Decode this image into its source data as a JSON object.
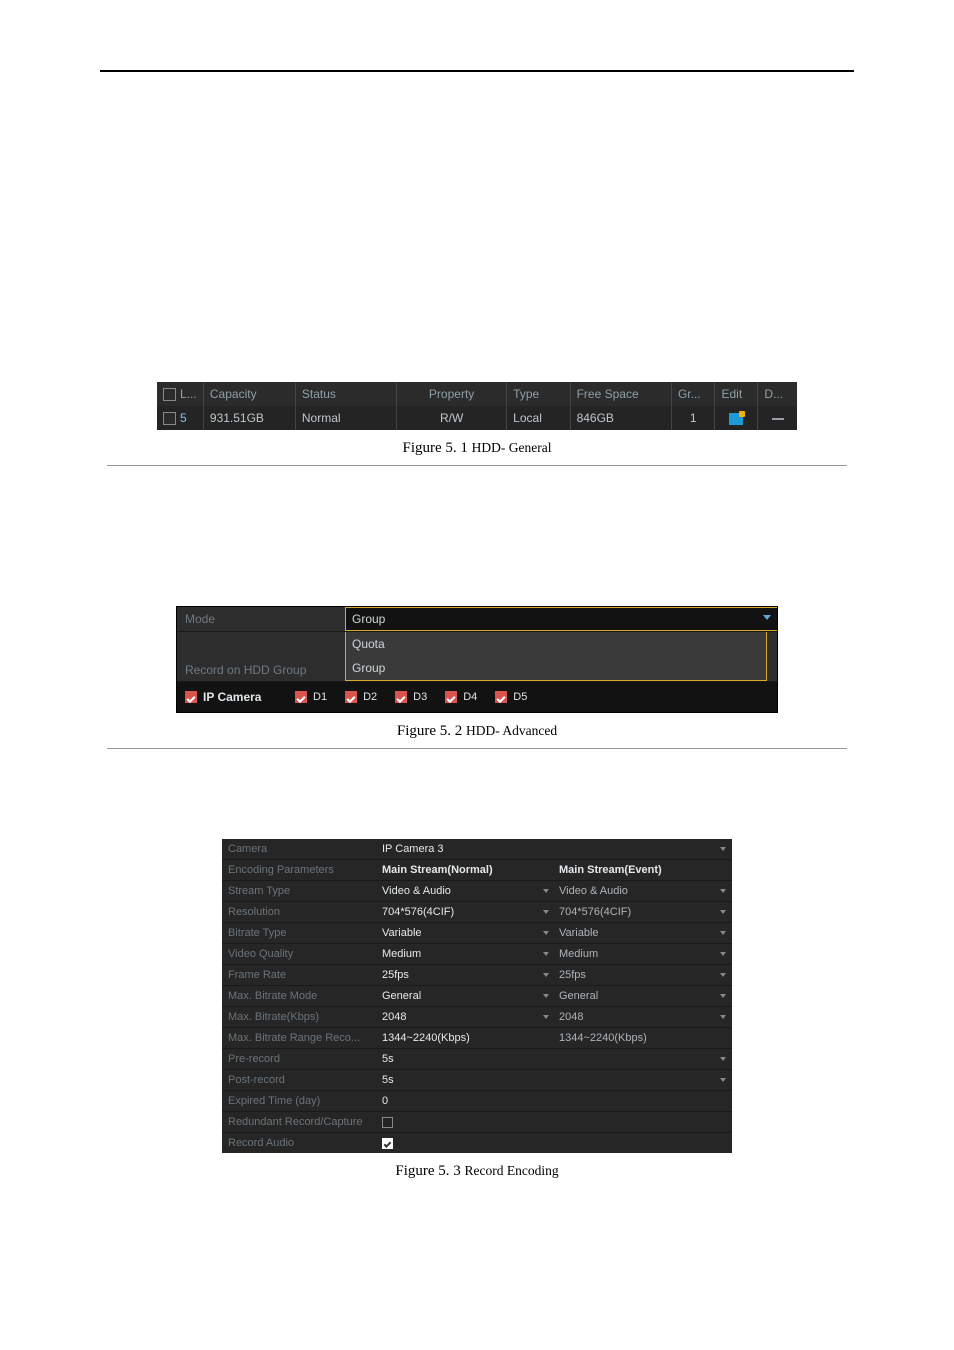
{
  "hdd_table": {
    "headers": {
      "col_l": "L...",
      "capacity": "Capacity",
      "status": "Status",
      "property": "Property",
      "type": "Type",
      "free_space": "Free Space",
      "group": "Gr...",
      "edit": "Edit",
      "del": "D..."
    },
    "row": {
      "l": "5",
      "capacity": "931.51GB",
      "status": "Normal",
      "property": "R/W",
      "type": "Local",
      "free_space": "846GB",
      "group": "1"
    }
  },
  "caption1_a": "Figure 5. 1 ",
  "caption1_b": "HDD- General",
  "mode_panel": {
    "mode_label": "Mode",
    "record_label": "Record on HDD Group",
    "options": {
      "quota": "Quota",
      "group": "Group"
    },
    "selected": "Group",
    "ip_camera": "IP Camera",
    "d1": "D1",
    "d2": "D2",
    "d3": "D3",
    "d4": "D4",
    "d5": "D5"
  },
  "caption2_a": "Figure 5. 2 ",
  "caption2_b": "HDD- Advanced",
  "enc": {
    "camera_label": "Camera",
    "camera_value": "IP Camera 3",
    "row_encparams": "Encoding Parameters",
    "c1_encparams": "Main Stream(Normal)",
    "c2_encparams": "Main Stream(Event)",
    "row_stream": "Stream Type",
    "c1_stream": "Video & Audio",
    "c2_stream": "Video & Audio",
    "row_res": "Resolution",
    "c1_res": "704*576(4CIF)",
    "c2_res": "704*576(4CIF)",
    "row_btype": "Bitrate Type",
    "c1_btype": "Variable",
    "c2_btype": "Variable",
    "row_vq": "Video Quality",
    "c1_vq": "Medium",
    "c2_vq": "Medium",
    "row_fr": "Frame Rate",
    "c1_fr": "25fps",
    "c2_fr": "25fps",
    "row_mbm": "Max. Bitrate Mode",
    "c1_mbm": "General",
    "c2_mbm": "General",
    "row_mbk": "Max. Bitrate(Kbps)",
    "c1_mbk": "2048",
    "c2_mbk": "2048",
    "row_mbr": "Max. Bitrate Range Reco...",
    "c1_mbr": "1344~2240(Kbps)",
    "c2_mbr": "1344~2240(Kbps)",
    "row_pre": "Pre-record",
    "v_pre": "5s",
    "row_post": "Post-record",
    "v_post": "5s",
    "row_exp": "Expired Time (day)",
    "v_exp": "0",
    "row_red": "Redundant Record/Capture",
    "row_aud": "Record Audio"
  },
  "caption3_a": "Figure 5. 3 ",
  "caption3_b": "Record Encoding"
}
